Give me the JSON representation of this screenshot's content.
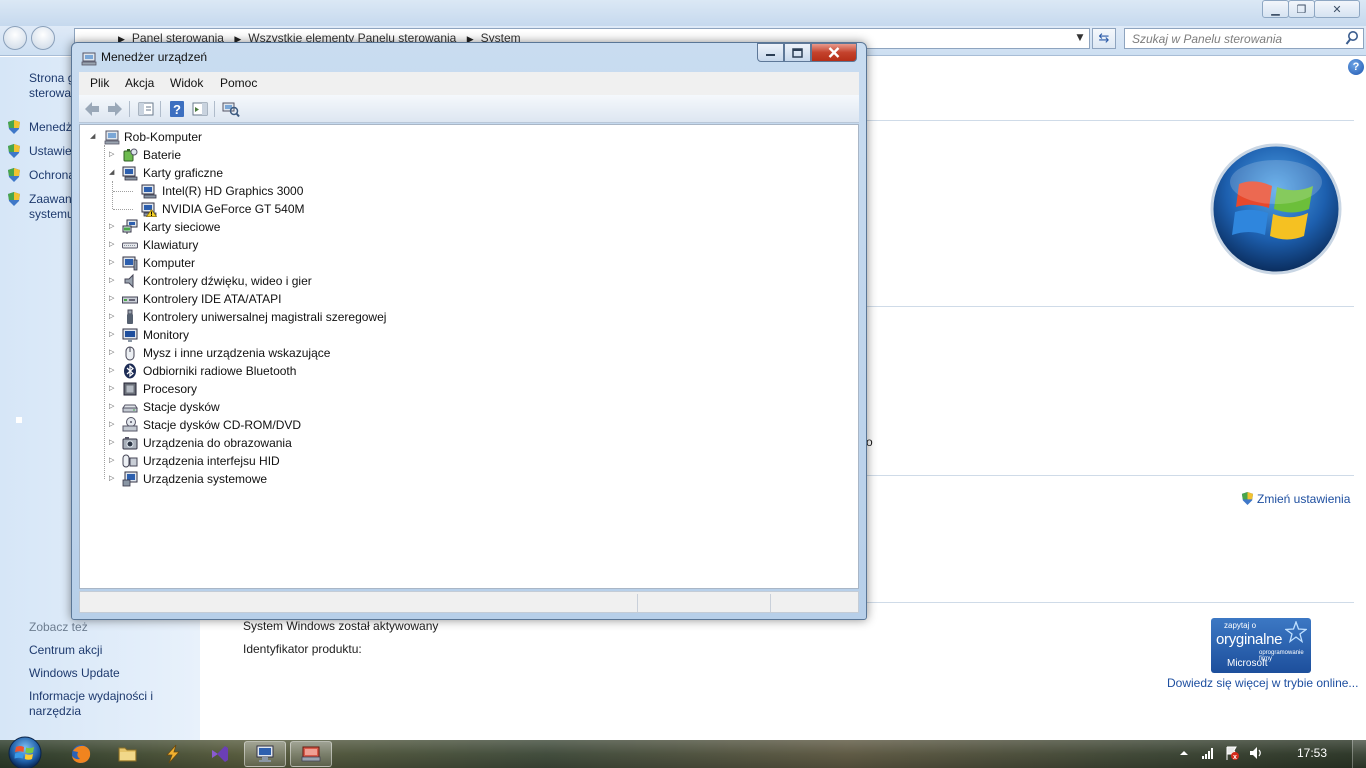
{
  "control_panel": {
    "breadcrumb": [
      "Panel sterowania",
      "Wszystkie elementy Panelu sterowania",
      "System"
    ],
    "search_placeholder": "Szukaj w Panelu sterowania",
    "sidebar": {
      "home_link": "Strona g",
      "home_link2": "sterowa",
      "items": [
        {
          "label": "Menedż",
          "label2": ""
        },
        {
          "label": "Ustawie",
          "label2": ""
        },
        {
          "label": "Ochrona",
          "label2": ""
        },
        {
          "label": "Zaawan",
          "label2": "systemu"
        }
      ],
      "see_also_heading": "Zobacz też",
      "see_also_links": [
        "Centrum akcji",
        "Windows Update",
        "Informacje wydajności i",
        "narzędzia"
      ]
    },
    "change_settings": "Zmień ustawienia",
    "activation_status": "System Windows został aktywowany",
    "product_id_label": "Identyfikator produktu:",
    "genuine_badge": {
      "line1": "zapytaj o",
      "line2": "oryginalne",
      "line3": "oprogramowanie firmy",
      "line4": "Microsoft"
    },
    "learn_more_link": "Dowiedz się więcej w trybie online...",
    "stray_char": "o"
  },
  "device_manager": {
    "title": "Menedżer urządzeń",
    "menu": [
      "Plik",
      "Akcja",
      "Widok",
      "Pomoc"
    ],
    "root": "Rob-Komputer",
    "categories": [
      {
        "label": "Baterie",
        "icon": "battery-icon",
        "expanded": false
      },
      {
        "label": "Karty graficzne",
        "icon": "display-adapter-icon",
        "expanded": true,
        "children": [
          {
            "label": "Intel(R) HD Graphics 3000",
            "icon": "display-adapter-icon",
            "warning": false
          },
          {
            "label": "NVIDIA GeForce GT 540M",
            "icon": "display-adapter-icon",
            "warning": true
          }
        ]
      },
      {
        "label": "Karty sieciowe",
        "icon": "network-adapter-icon",
        "expanded": false
      },
      {
        "label": "Klawiatury",
        "icon": "keyboard-icon",
        "expanded": false
      },
      {
        "label": "Komputer",
        "icon": "computer-icon",
        "expanded": false
      },
      {
        "label": "Kontrolery dźwięku, wideo i gier",
        "icon": "speaker-icon",
        "expanded": false
      },
      {
        "label": "Kontrolery IDE ATA/ATAPI",
        "icon": "ide-controller-icon",
        "expanded": false
      },
      {
        "label": "Kontrolery uniwersalnej magistrali szeregowej",
        "icon": "usb-icon",
        "expanded": false
      },
      {
        "label": "Monitory",
        "icon": "monitor-icon",
        "expanded": false
      },
      {
        "label": "Mysz i inne urządzenia wskazujące",
        "icon": "mouse-icon",
        "expanded": false
      },
      {
        "label": "Odbiorniki radiowe Bluetooth",
        "icon": "bluetooth-icon",
        "expanded": false
      },
      {
        "label": "Procesory",
        "icon": "processor-icon",
        "expanded": false
      },
      {
        "label": "Stacje dysków",
        "icon": "disk-drive-icon",
        "expanded": false
      },
      {
        "label": "Stacje dysków CD-ROM/DVD",
        "icon": "cdrom-icon",
        "expanded": false
      },
      {
        "label": "Urządzenia do obrazowania",
        "icon": "camera-icon",
        "expanded": false
      },
      {
        "label": "Urządzenia interfejsu HID",
        "icon": "hid-icon",
        "expanded": false
      },
      {
        "label": "Urządzenia systemowe",
        "icon": "system-device-icon",
        "expanded": false
      }
    ]
  },
  "taskbar": {
    "clock": "17:53",
    "apps": [
      "firefox-icon",
      "explorer-icon",
      "winamp-icon",
      "visual-studio-icon",
      "control-panel-icon",
      "device-manager-icon"
    ]
  }
}
